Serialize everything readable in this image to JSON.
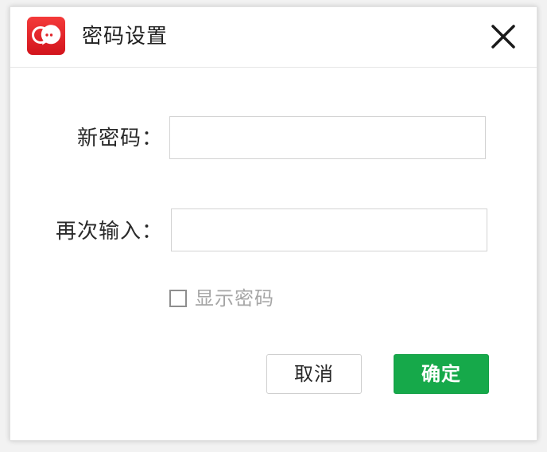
{
  "dialog": {
    "title": "密码设置",
    "app_icon": "chat-bubble-icon",
    "close_icon": "close-icon"
  },
  "form": {
    "new_password_label": "新密码：",
    "new_password_value": "",
    "repeat_password_label": "再次输入：",
    "repeat_password_value": "",
    "show_password_label": "显示密码",
    "show_password_checked": false
  },
  "buttons": {
    "cancel_label": "取消",
    "confirm_label": "确定"
  },
  "colors": {
    "brand_red": "#e0242a",
    "confirm_green": "#16a94a"
  }
}
